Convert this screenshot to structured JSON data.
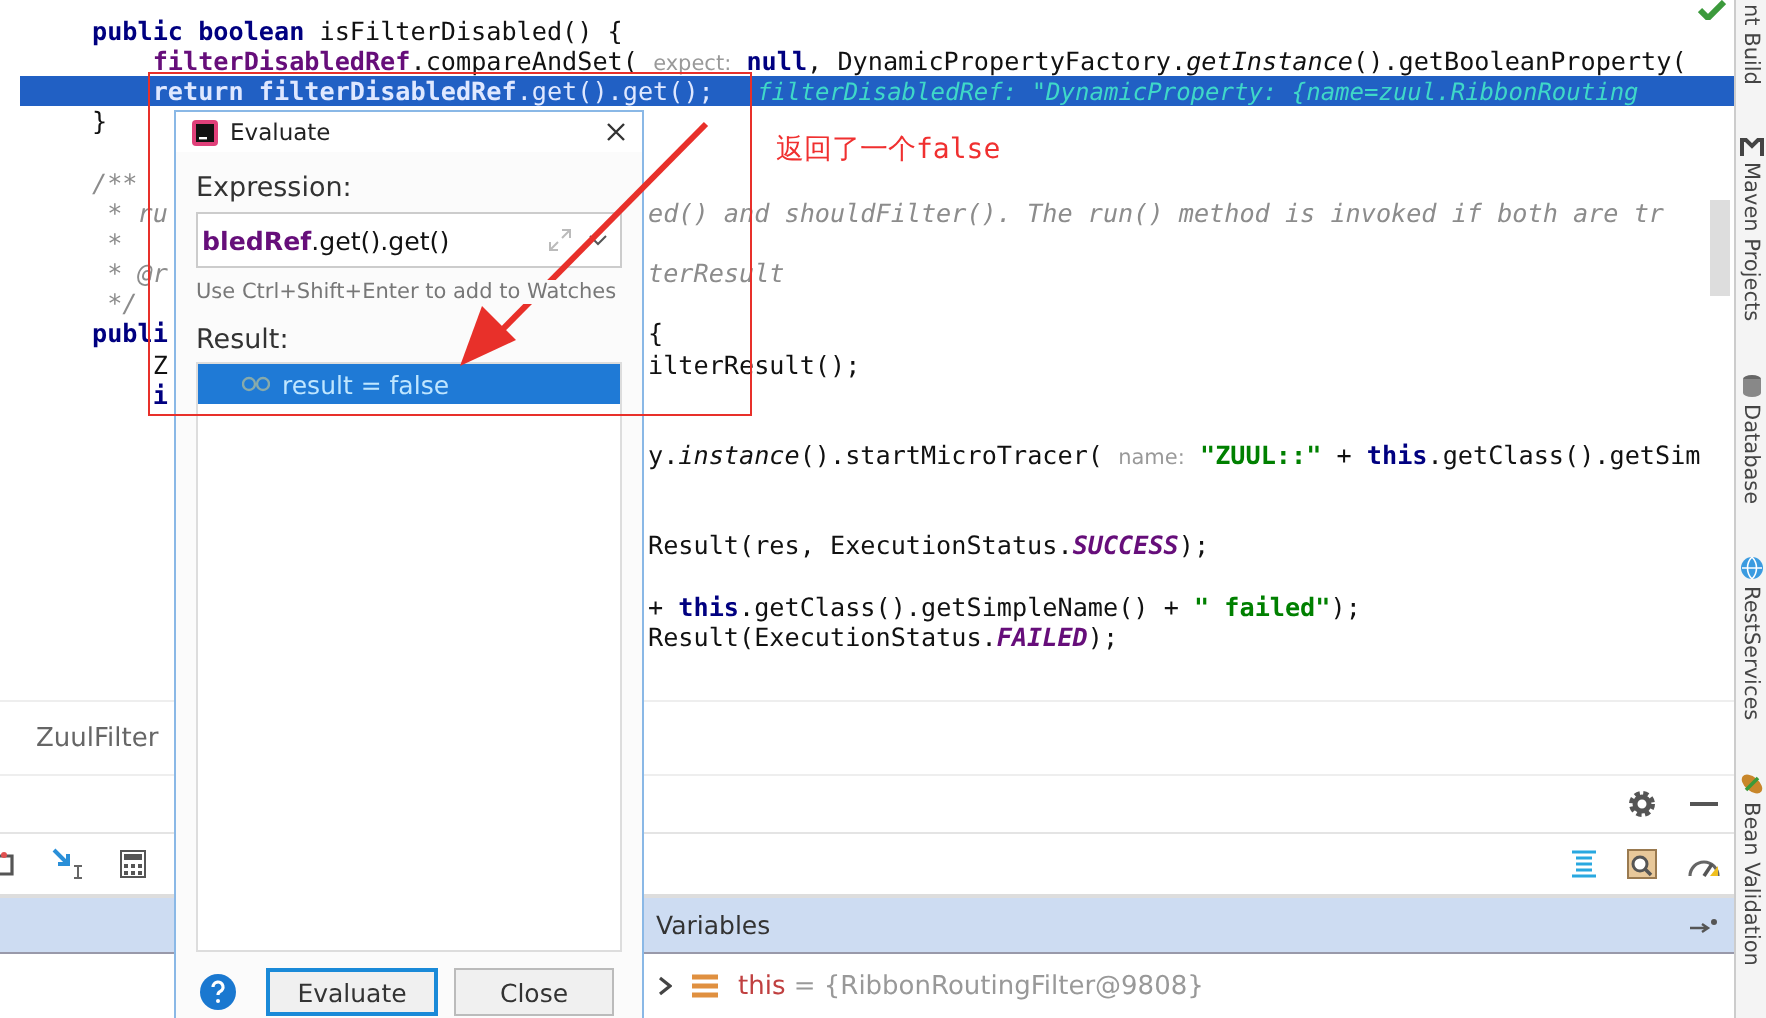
{
  "editor": {
    "lines": [
      {
        "kind": "code",
        "left": [
          {
            "kind": "kw",
            "text": "public boolean "
          },
          {
            "kind": "plain",
            "text": "isFilterDisabled() {"
          }
        ]
      },
      {
        "kind": "code",
        "left": [
          {
            "kind": "field",
            "text": "    filterDisabledRef"
          },
          {
            "kind": "plain",
            "text": ".compareAndSet( "
          },
          {
            "kind": "hint",
            "text": "expect:"
          },
          {
            "kind": "kw",
            "text": " null"
          },
          {
            "kind": "plain",
            "text": ", DynamicPropertyFactory."
          },
          {
            "kind": "italic",
            "text": "getInstance"
          },
          {
            "kind": "plain",
            "text": "().getBooleanProperty("
          }
        ]
      },
      {
        "kind": "current",
        "left": [
          {
            "kind": "kw",
            "text": "    return "
          },
          {
            "kind": "field",
            "text": "filterDisabledRef"
          },
          {
            "kind": "plain",
            "text": ".get().get();"
          },
          {
            "kind": "value",
            "text": "   filterDisabledRef: \"DynamicProperty: {name=zuul.RibbonRouting"
          }
        ]
      },
      {
        "kind": "code",
        "left": [
          {
            "kind": "plain",
            "text": "}"
          }
        ]
      },
      {
        "kind": "blank"
      },
      {
        "kind": "code",
        "left": [
          {
            "kind": "comment",
            "text": "/**"
          }
        ]
      },
      {
        "kind": "code",
        "left": [
          {
            "kind": "comment",
            "text": " * ru"
          }
        ],
        "right": [
          {
            "kind": "comment",
            "text": "ed() and shouldFilter(). The run() method is invoked if both are tr"
          }
        ]
      },
      {
        "kind": "code",
        "left": [
          {
            "kind": "comment",
            "text": " *"
          }
        ]
      },
      {
        "kind": "code",
        "left": [
          {
            "kind": "comment",
            "text": " * @r"
          }
        ],
        "right": [
          {
            "kind": "comment",
            "text": "terResult"
          }
        ]
      },
      {
        "kind": "code",
        "left": [
          {
            "kind": "comment",
            "text": " */"
          }
        ]
      },
      {
        "kind": "code",
        "left": [
          {
            "kind": "kw",
            "text": "publi"
          }
        ],
        "right": [
          {
            "kind": "plain",
            "text": "{"
          }
        ]
      },
      {
        "kind": "code",
        "left": [
          {
            "kind": "plain",
            "text": "    Z"
          }
        ],
        "right": [
          {
            "kind": "plain",
            "text": "ilterResult();"
          }
        ]
      },
      {
        "kind": "code",
        "left": [
          {
            "kind": "kw",
            "text": "    i"
          }
        ]
      },
      {
        "kind": "blank"
      },
      {
        "kind": "code",
        "right": [
          {
            "kind": "plain",
            "text": "y."
          },
          {
            "kind": "italic",
            "text": "instance"
          },
          {
            "kind": "plain",
            "text": "().startMicroTracer( "
          },
          {
            "kind": "hint",
            "text": "name:"
          },
          {
            "kind": "str",
            "text": " \"ZUUL::\""
          },
          {
            "kind": "plain",
            "text": " + "
          },
          {
            "kind": "kw",
            "text": "this"
          },
          {
            "kind": "plain",
            "text": ".getClass().getSim"
          }
        ]
      },
      {
        "kind": "blank"
      },
      {
        "kind": "blank"
      },
      {
        "kind": "code",
        "right": [
          {
            "kind": "plain",
            "text": "Result(res, ExecutionStatus."
          },
          {
            "kind": "const",
            "text": "SUCCESS"
          },
          {
            "kind": "plain",
            "text": ");"
          }
        ]
      },
      {
        "kind": "blank"
      },
      {
        "kind": "code",
        "right": [
          {
            "kind": "plain",
            "text": "+ "
          },
          {
            "kind": "kw",
            "text": "this"
          },
          {
            "kind": "plain",
            "text": ".getClass().getSimpleName() + "
          },
          {
            "kind": "str",
            "text": "\" failed\""
          },
          {
            "kind": "plain",
            "text": ");"
          }
        ]
      },
      {
        "kind": "code",
        "right": [
          {
            "kind": "plain",
            "text": "Result(ExecutionStatus."
          },
          {
            "kind": "const",
            "text": "FAILED"
          },
          {
            "kind": "plain",
            "text": ");"
          }
        ]
      }
    ]
  },
  "breadcrumb": "ZuulFilter",
  "variables": {
    "title": "Variables",
    "rows": [
      {
        "expanded": false,
        "tokens": [
          {
            "kind": "var",
            "text": "this"
          },
          {
            "kind": "gray",
            "text": " = {RibbonRoutingFilter@9808}"
          }
        ]
      }
    ]
  },
  "tool_windows": [
    {
      "label": "nt Build",
      "kind": "build"
    },
    {
      "label": "Maven Projects",
      "kind": "maven"
    },
    {
      "label": "Database",
      "kind": "database"
    },
    {
      "label": "RestServices",
      "kind": "globe"
    },
    {
      "label": "Bean Validation",
      "kind": "bean"
    }
  ],
  "dialog": {
    "title": "Evaluate",
    "expression_label": "Expression:",
    "expression": [
      {
        "kind": "field",
        "text": "bledRef"
      },
      {
        "kind": "plain",
        "text": ".get().get()"
      }
    ],
    "hint": "Use Ctrl+Shift+Enter to add to Watches",
    "result_label": "Result:",
    "results": [
      {
        "text": "result = false",
        "selected": true
      }
    ],
    "buttons": [
      {
        "label": "Evaluate",
        "default": true
      },
      {
        "label": "Close",
        "default": false
      }
    ]
  },
  "annotation": {
    "text": "返回了一个false"
  }
}
